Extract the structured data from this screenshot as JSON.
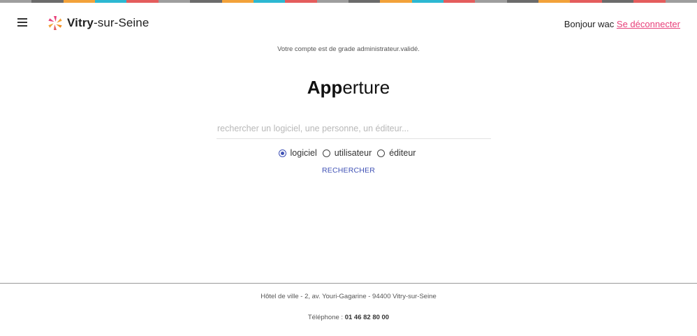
{
  "stripe_colors": [
    "#9e9e9e",
    "#6b6b6b",
    "#f2a23a",
    "#2cb8d2",
    "#e45d5d",
    "#9e9e9e",
    "#6b6b6b",
    "#f2a23a",
    "#2cb8d2",
    "#e45d5d",
    "#9e9e9e",
    "#6b6b6b",
    "#f2a23a",
    "#2cb8d2",
    "#e45d5d",
    "#9e9e9e",
    "#6b6b6b",
    "#f2a23a",
    "#e45d5d",
    "#6b6b6b",
    "#e45d5d",
    "#9e9e9e"
  ],
  "header": {
    "menu_icon": "hamburger-icon",
    "logo_icon": "vitry-flower-logo",
    "brand_bold": "Vitry",
    "brand_rest": "-sur-Seine",
    "greeting": "Bonjour wac",
    "logout_label": "Se déconnecter"
  },
  "notice": "Votre compte est de grade administrateur.validé.",
  "app_title": {
    "bold": "App",
    "rest": "erture"
  },
  "search": {
    "placeholder": "rechercher un logiciel, une personne, un éditeur...",
    "value": ""
  },
  "search_types": [
    {
      "label": "logiciel",
      "checked": true
    },
    {
      "label": "utilisateur",
      "checked": false
    },
    {
      "label": "éditeur",
      "checked": false
    }
  ],
  "search_button": "RECHERCHER",
  "footer": {
    "address": "Hôtel de ville - 2, av. Youri-Gagarine - 94400 Vitry-sur-Seine",
    "phone_label": "Téléphone :",
    "phone_number": "01 46 82 80 00"
  },
  "colors": {
    "accent": "#3f51b5",
    "logout": "#e8407a"
  }
}
